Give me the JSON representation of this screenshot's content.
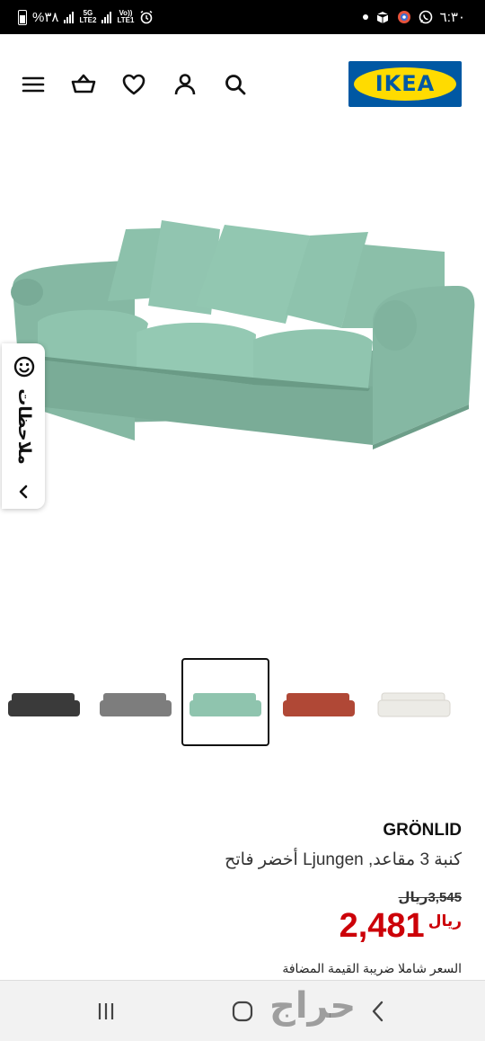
{
  "status_bar": {
    "battery_text": "%٣٨",
    "net1": "5G",
    "net1_sub": "LTE2",
    "net2": "Vo))",
    "net2_sub": "LTE1",
    "time": "٦:٣٠"
  },
  "header": {
    "logo_text": "IKEA",
    "icons": [
      "menu-icon",
      "basket-icon",
      "heart-icon",
      "user-icon",
      "search-icon"
    ]
  },
  "feedback": {
    "label": "ملاحظات"
  },
  "thumbnails": {
    "colors": [
      "#3a3a3a",
      "#7d7d7d",
      "#8fc4ae",
      "#b04836",
      "#ecebe6"
    ],
    "selected_index": 2
  },
  "product": {
    "name": "GRÖNLID",
    "description": "كنبة 3 مقاعد, Ljungen أخضر فاتح",
    "old_price": "3,545ريال",
    "currency": "ريال",
    "price": "2,481",
    "vat_note": "السعر شاملا ضريبة القيمة المضافة",
    "price_color": "#cc0008"
  },
  "watermark": "حراج"
}
